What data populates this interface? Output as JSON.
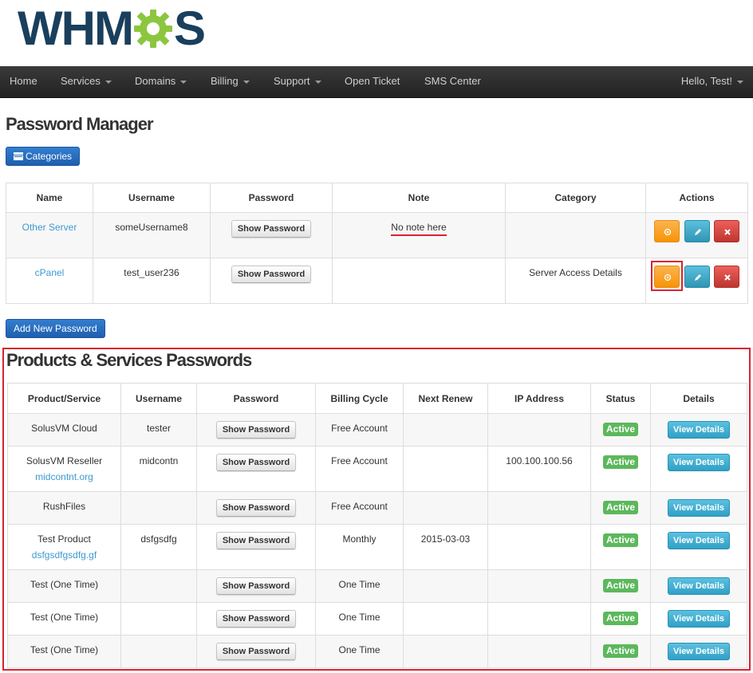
{
  "logo": {
    "text_left": "WHM",
    "text_right": "S",
    "brand_color": "#1a3f5c",
    "gear_color": "#8cc63f"
  },
  "navbar": {
    "items": [
      {
        "label": "Home",
        "dropdown": false
      },
      {
        "label": "Services",
        "dropdown": true
      },
      {
        "label": "Domains",
        "dropdown": true
      },
      {
        "label": "Billing",
        "dropdown": true
      },
      {
        "label": "Support",
        "dropdown": true
      },
      {
        "label": "Open Ticket",
        "dropdown": false
      },
      {
        "label": "SMS Center",
        "dropdown": false
      }
    ],
    "user": "Hello, Test!"
  },
  "password_manager": {
    "title": "Password Manager",
    "categories_button": "Categories",
    "columns": [
      "Name",
      "Username",
      "Password",
      "Note",
      "Category",
      "Actions"
    ],
    "show_password_label": "Show Password",
    "rows": [
      {
        "name": "Other Server",
        "username": "someUsername8",
        "note": "No note here",
        "category": ""
      },
      {
        "name": "cPanel",
        "username": "test_user236",
        "note": "",
        "category": "Server Access Details"
      }
    ],
    "add_button": "Add New Password"
  },
  "products": {
    "title": "Products & Services Passwords",
    "columns": [
      "Product/Service",
      "Username",
      "Password",
      "Billing Cycle",
      "Next Renew",
      "IP Address",
      "Status",
      "Details"
    ],
    "show_password_label": "Show Password",
    "view_details_label": "View Details",
    "rows": [
      {
        "product": "SolusVM Cloud",
        "domain": "",
        "username": "tester",
        "billing": "Free Account",
        "renew": "",
        "ip": "",
        "status": "Active"
      },
      {
        "product": "SolusVM Reseller",
        "domain": "midcontnt.org",
        "username": "midcontn",
        "billing": "Free Account",
        "renew": "",
        "ip": "100.100.100.56",
        "status": "Active"
      },
      {
        "product": "RushFiles",
        "domain": "",
        "username": "",
        "billing": "Free Account",
        "renew": "",
        "ip": "",
        "status": "Active"
      },
      {
        "product": "Test Product",
        "domain": "dsfgsdfgsdfg.gf",
        "username": "dsfgsdfg",
        "billing": "Monthly",
        "renew": "2015-03-03",
        "ip": "",
        "status": "Active"
      },
      {
        "product": "Test (One Time)",
        "domain": "",
        "username": "",
        "billing": "One Time",
        "renew": "",
        "ip": "",
        "status": "Active"
      },
      {
        "product": "Test (One Time)",
        "domain": "",
        "username": "",
        "billing": "One Time",
        "renew": "",
        "ip": "",
        "status": "Active"
      },
      {
        "product": "Test (One Time)",
        "domain": "",
        "username": "",
        "billing": "One Time",
        "renew": "",
        "ip": "",
        "status": "Active"
      }
    ]
  },
  "colors": {
    "highlight": "#d9232d",
    "link": "#3d9ad1",
    "active": "#5cb85c"
  }
}
